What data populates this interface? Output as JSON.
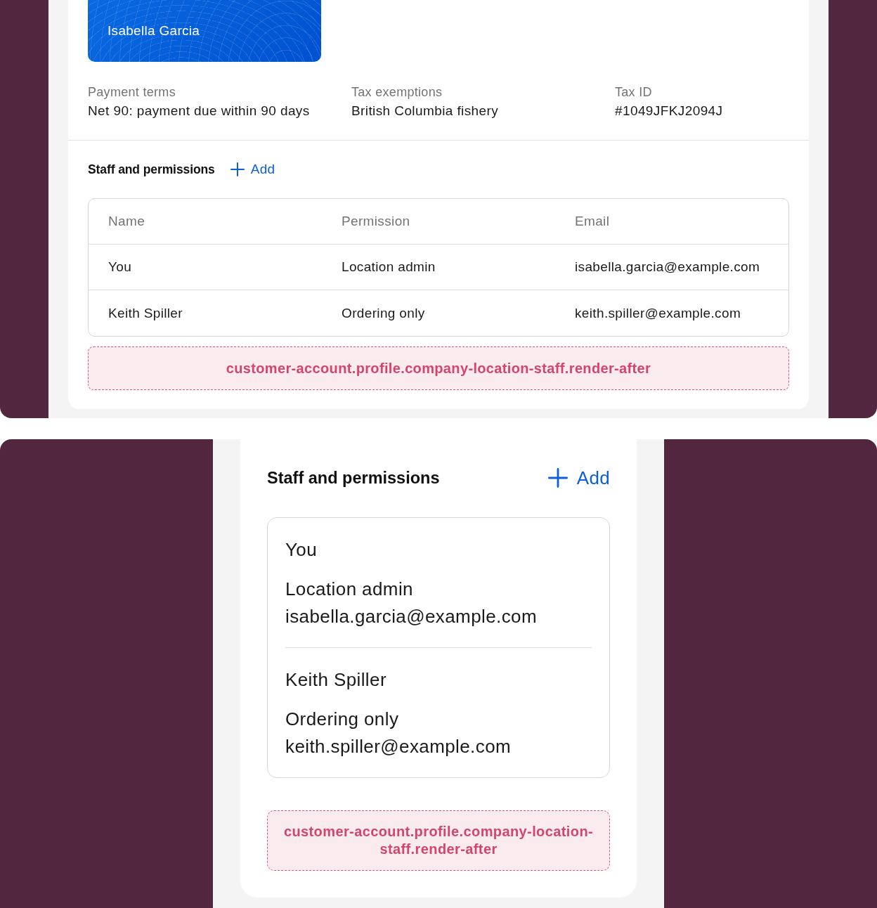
{
  "desktop_view": {
    "card": {
      "holder": "Isabella Garcia"
    },
    "details": [
      {
        "label": "Payment terms",
        "value": "Net 90: payment due within 90 days"
      },
      {
        "label": "Tax exemptions",
        "value": "British Columbia fishery"
      },
      {
        "label": "Tax ID",
        "value": "#1049JFKJ2094J"
      }
    ],
    "staff": {
      "title": "Staff and permissions",
      "add_label": "Add",
      "columns": [
        "Name",
        "Permission",
        "Email"
      ],
      "rows": [
        {
          "name": "You",
          "permission": "Location admin",
          "email": "isabella.garcia@example.com"
        },
        {
          "name": "Keith Spiller",
          "permission": "Ordering only",
          "email": "keith.spiller@example.com"
        }
      ]
    },
    "extension_target": "customer-account.profile.company-location-staff.render-after"
  },
  "mobile_view": {
    "staff": {
      "title": "Staff and permissions",
      "add_label": "Add",
      "rows": [
        {
          "name": "You",
          "permission": "Location admin",
          "email": "isabella.garcia@example.com"
        },
        {
          "name": "Keith Spiller",
          "permission": "Ordering only",
          "email": "keith.spiller@example.com"
        }
      ]
    },
    "extension_target": "customer-account.profile.company-location-staff.render-after"
  }
}
